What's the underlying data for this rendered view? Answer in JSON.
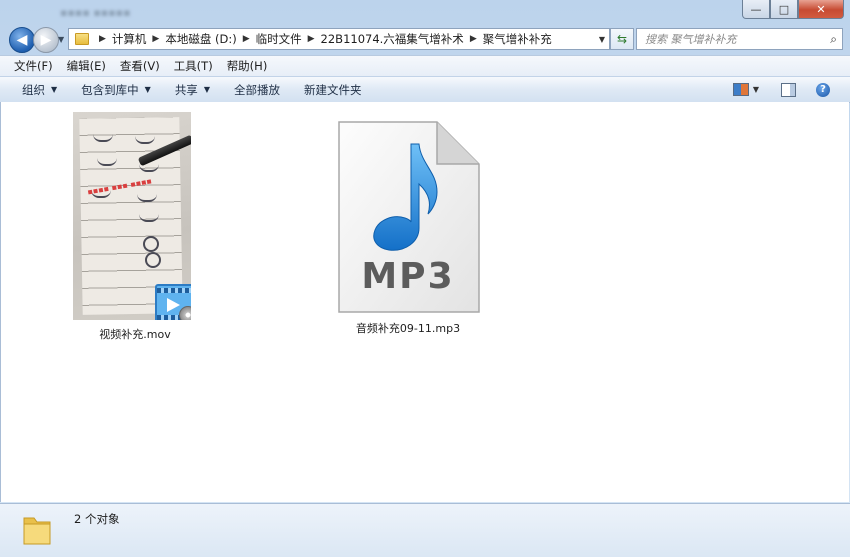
{
  "window": {
    "controls": {
      "minimize": "—",
      "maximize": "□",
      "close": "✕"
    }
  },
  "nav": {
    "back_glyph": "◀",
    "forward_glyph": "▶",
    "breadcrumbs": [
      "计算机",
      "本地磁盘 (D:)",
      "临时文件",
      "22B11074.六福集气增补术",
      "聚气增补补充"
    ],
    "search_placeholder": "搜索 聚气增补补充"
  },
  "menu": [
    "文件(F)",
    "编辑(E)",
    "查看(V)",
    "工具(T)",
    "帮助(H)"
  ],
  "commands": [
    {
      "label": "组织",
      "dropdown": true
    },
    {
      "label": "包含到库中",
      "dropdown": true
    },
    {
      "label": "共享",
      "dropdown": true
    },
    {
      "label": "全部播放",
      "dropdown": false
    },
    {
      "label": "新建文件夹",
      "dropdown": false
    }
  ],
  "files": [
    {
      "name": "视频补充.mov",
      "kind": "video",
      "icon": "video-thumbnail-icon"
    },
    {
      "name": "音频补充09-11.mp3",
      "kind": "audio",
      "badge": "MP3",
      "icon": "mp3-file-icon"
    }
  ],
  "status": {
    "text": "2 个对象"
  },
  "colors": {
    "note_blue": "#1a7fd8",
    "accent": "#3b78c0"
  }
}
